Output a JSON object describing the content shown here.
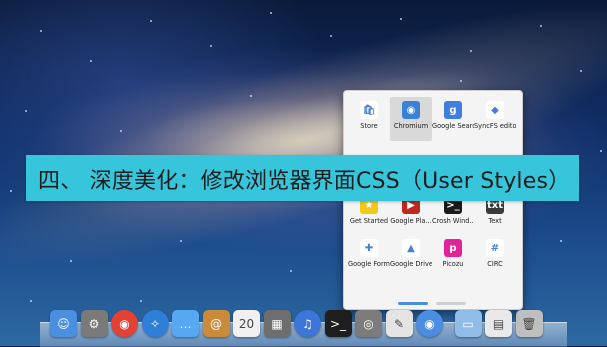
{
  "banner": {
    "text": "四、 深度美化：修改浏览器界面CSS（User Styles）"
  },
  "launcher": {
    "apps": [
      {
        "label": "Store",
        "icon": "store-icon",
        "color": "#ffffff",
        "glyph": "🛍"
      },
      {
        "label": "Chromium",
        "icon": "chromium-icon",
        "color": "#3b82d6",
        "glyph": "◉"
      },
      {
        "label": "Google Search",
        "icon": "google-search-icon",
        "color": "#3f7fe0",
        "glyph": "g"
      },
      {
        "label": "SyncFS editor",
        "icon": "syncfs-editor-icon",
        "color": "#ffffff",
        "glyph": "◆"
      },
      {
        "label": "Get Started",
        "icon": "get-started-icon",
        "color": "#f2c81a",
        "glyph": "★"
      },
      {
        "label": "Google Pla...",
        "icon": "google-play-icon",
        "color": "#c0271f",
        "glyph": "▶"
      },
      {
        "label": "Crosh Wind...",
        "icon": "crosh-window-icon",
        "color": "#1a1a1a",
        "glyph": ">_"
      },
      {
        "label": "Text",
        "icon": "text-icon",
        "color": "#3a3a3a",
        "glyph": "txt"
      },
      {
        "label": "Google Forms",
        "icon": "google-forms-icon",
        "color": "#ffffff",
        "glyph": "✚"
      },
      {
        "label": "Google Drive",
        "icon": "google-drive-icon",
        "color": "#ffffff",
        "glyph": "▲"
      },
      {
        "label": "Picozu",
        "icon": "picozu-icon",
        "color": "#e0239a",
        "glyph": "p"
      },
      {
        "label": "CIRC",
        "icon": "circ-icon",
        "color": "#ffffff",
        "glyph": "#"
      }
    ],
    "page_indicators": [
      {
        "color": "#4a90d9"
      },
      {
        "color": "#cfcfcf"
      }
    ]
  },
  "dock": {
    "items": [
      {
        "icon": "finder-icon",
        "color": "#4a8fe0",
        "glyph": "☺"
      },
      {
        "icon": "system-preferences-icon",
        "color": "#7a7a7a",
        "glyph": "⚙"
      },
      {
        "icon": "chrome-icon",
        "color": "#e34133",
        "glyph": "◉"
      },
      {
        "icon": "safari-icon",
        "color": "#2f7fd8",
        "glyph": "✧"
      },
      {
        "icon": "messages-icon",
        "color": "#56a8f2",
        "glyph": "…"
      },
      {
        "icon": "contacts-icon",
        "color": "#c98b3a",
        "glyph": "@"
      },
      {
        "icon": "calendar-icon",
        "color": "#f0f0f0",
        "glyph": "20"
      },
      {
        "icon": "photos-icon",
        "color": "#6e6e6e",
        "glyph": "▦"
      },
      {
        "icon": "itunes-icon",
        "color": "#3b76d8",
        "glyph": "♫"
      },
      {
        "icon": "terminal-icon",
        "color": "#1e1e1e",
        "glyph": ">_"
      },
      {
        "icon": "preview-icon",
        "color": "#7c7c7c",
        "glyph": "◎"
      },
      {
        "icon": "script-editor-icon",
        "color": "#e4e4e4",
        "glyph": "✎"
      },
      {
        "icon": "chromium-dock-icon",
        "color": "#4b8de0",
        "glyph": "◉"
      },
      {
        "icon": "folder-icon",
        "color": "#8fbde8",
        "glyph": "▭"
      },
      {
        "icon": "document-icon",
        "color": "#e9e9e9",
        "glyph": "▤"
      },
      {
        "icon": "trash-icon",
        "color": "#bfbfbf",
        "glyph": "🗑"
      }
    ]
  }
}
